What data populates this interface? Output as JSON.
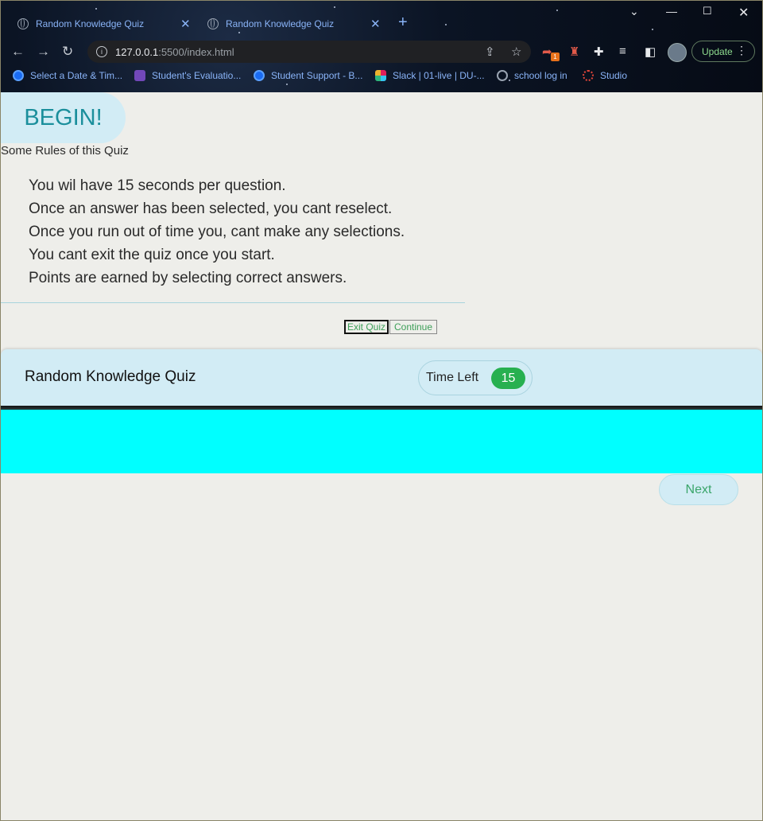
{
  "browser": {
    "tabs": [
      {
        "title": "Random Knowledge Quiz"
      },
      {
        "title": "Random Knowledge Quiz"
      }
    ],
    "url_host": "127.0.0.1",
    "url_rest": ":5500/index.html",
    "update_label": "Update",
    "extension_badge": "1",
    "bookmarks": [
      {
        "label": "Select a Date & Tim...",
        "icon": "calendly-icon"
      },
      {
        "label": "Student's Evaluatio...",
        "icon": "form-icon"
      },
      {
        "label": "Student Support - B...",
        "icon": "calendly-icon"
      },
      {
        "label": "Slack | 01-live | DU-...",
        "icon": "slack-icon"
      },
      {
        "label": "school log in",
        "icon": "globe-icon"
      },
      {
        "label": "Studio",
        "icon": "studio-icon"
      }
    ]
  },
  "page": {
    "begin_label": "BEGIN!",
    "rules_title": "Some Rules of this Quiz",
    "rules": [
      "You wil have 15 seconds per question.",
      "Once an answer has been selected, you cant reselect.",
      "Once you run out of time you, cant make any selections.",
      "You cant exit the quiz once you start.",
      "Points are earned by selecting correct answers."
    ],
    "exit_label": "Exit Quiz",
    "continue_label": "Continue",
    "quiz_title": "Random Knowledge Quiz",
    "timer_label": "Time Left",
    "timer_value": "15",
    "next_label": "Next"
  },
  "colors": {
    "accent": "#1b8f9c",
    "panel": "#d2ecf5",
    "timer": "#27b050",
    "question_area": "#00ffff"
  }
}
